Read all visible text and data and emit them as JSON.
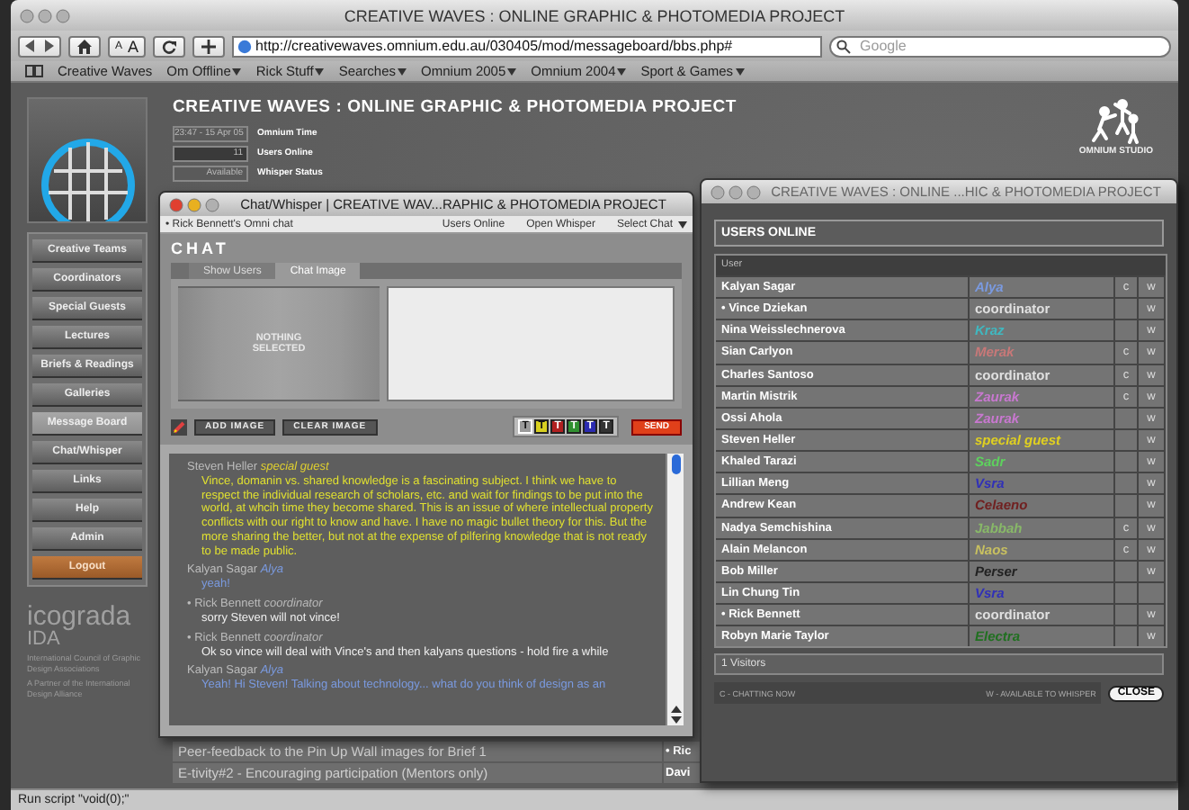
{
  "browser": {
    "title": "CREATIVE WAVES : ONLINE GRAPHIC & PHOTOMEDIA PROJECT",
    "font_buttons": [
      "A",
      "A"
    ],
    "url": "http://creativewaves.omnium.edu.au/030405/mod/messageboard/bbs.php#",
    "search": {
      "placeholder": "Google"
    },
    "bookmarks": [
      {
        "label": "Creative Waves",
        "menu": false
      },
      {
        "label": "Om Offline",
        "menu": true
      },
      {
        "label": "Rick Stuff",
        "menu": true
      },
      {
        "label": "Searches",
        "menu": true
      },
      {
        "label": "Omnium 2005",
        "menu": true
      },
      {
        "label": "Omnium 2004",
        "menu": true
      },
      {
        "label": "Sport & Games",
        "menu": true
      }
    ],
    "status_bar": "Run script \"void(0);\""
  },
  "header": {
    "title": "CREATIVE WAVES : ONLINE GRAPHIC & PHOTOMEDIA PROJECT",
    "studio": "OMNIUM STUDIO",
    "info": [
      {
        "value": "23:47 - 15 Apr 05",
        "label": "Omnium Time"
      },
      {
        "value": "11",
        "label": "Users Online"
      },
      {
        "value": "Available",
        "label": "Whisper Status"
      }
    ]
  },
  "sidebar": {
    "items": [
      {
        "label": "Creative Teams",
        "kind": "nav",
        "selected": false
      },
      {
        "label": "Coordinators",
        "kind": "nav",
        "selected": false
      },
      {
        "label": "Special Guests",
        "kind": "nav",
        "selected": false
      },
      {
        "label": "Lectures",
        "kind": "nav",
        "selected": false
      },
      {
        "label": "Briefs & Readings",
        "kind": "nav",
        "selected": false
      },
      {
        "label": "Galleries",
        "kind": "nav",
        "selected": false
      },
      {
        "label": "Message Board",
        "kind": "nav",
        "selected": true
      },
      {
        "label": "Chat/Whisper",
        "kind": "nav",
        "selected": false
      },
      {
        "label": "Links",
        "kind": "nav",
        "selected": false
      },
      {
        "label": "Help",
        "kind": "nav",
        "selected": false
      },
      {
        "label": "Admin",
        "kind": "nav",
        "selected": false
      },
      {
        "label": "Logout",
        "kind": "logout",
        "selected": false
      }
    ],
    "partner": {
      "name": "icograda",
      "sub": "IDA",
      "lines": [
        "International Council of Graphic Design Associations",
        "A Partner of the International Design Alliance"
      ]
    }
  },
  "message_board": {
    "rows": [
      {
        "topic": "Peer-feedback to the Pin Up Wall images for Brief 1",
        "author": "• Ric"
      },
      {
        "topic": "E-tivity#2 - Encouraging participation (Mentors only)",
        "author": "Davi"
      }
    ]
  },
  "chat_window": {
    "title": "Chat/Whisper | CREATIVE WAV...RAPHIC & PHOTOMEDIA PROJECT",
    "active": true,
    "room": "• Rick Bennett's Omni chat",
    "menu": [
      "Users Online",
      "Open Whisper",
      "Select Chat"
    ],
    "heading": "CHAT",
    "tabs": [
      {
        "label": "Show Users",
        "selected": false
      },
      {
        "label": "Chat Image",
        "selected": true
      }
    ],
    "image_placeholder": "NOTHING SELECTED",
    "buttons": [
      "ADD IMAGE",
      "CLEAR IMAGE"
    ],
    "text_colors": [
      {
        "label": "T",
        "color": "#9a9a9a",
        "selected": true
      },
      {
        "label": "T",
        "color": "#d8d020",
        "selected": false
      },
      {
        "label": "T",
        "color": "#b02020",
        "selected": false
      },
      {
        "label": "T",
        "color": "#309030",
        "selected": false
      },
      {
        "label": "T",
        "color": "#2a2ab0",
        "selected": false
      },
      {
        "label": "T",
        "color": "#333333",
        "selected": false
      }
    ],
    "send": "SEND",
    "messages": [
      {
        "author": "Steven Heller",
        "role": {
          "text": "special guest",
          "color": "#e0d030"
        },
        "color": "#e0e030",
        "text": "Vince, domanin vs. shared knowledge is a fascinating subject. I think we have to respect the individual research of scholars, etc. and wait for findings to be put into the world, at whcih time they become shared. This is an issue of where intellectual property conflicts with our right to know and have. I have no magic bullet theory for this. But the more sharing the better, but not at the expense of pilfering knowledge that is not ready to be made public."
      },
      {
        "author": "Kalyan Sagar",
        "role": {
          "text": "Alya",
          "color": "#7a9ae0"
        },
        "color": "#7a9ae0",
        "text": "yeah!"
      },
      {
        "author": "• Rick Bennett",
        "role": {
          "text": "coordinator",
          "color": "#b8b8b8"
        },
        "color": "#f0f0f0",
        "text": "sorry Steven will not vince!"
      },
      {
        "author": "• Rick Bennett",
        "role": {
          "text": "coordinator",
          "color": "#b8b8b8"
        },
        "color": "#f0f0f0",
        "text": "Ok so vince will deal with Vince's and then kalyans questions - hold fire a while"
      },
      {
        "author": "Kalyan Sagar",
        "role": {
          "text": "Alya",
          "color": "#7a9ae0"
        },
        "color": "#7a9ae0",
        "text": "Yeah! Hi Steven! Talking about technology... what do you think of design as an"
      }
    ]
  },
  "users_window": {
    "title": "CREATIVE WAVES : ONLINE ...HIC & PHOTOMEDIA PROJECT",
    "active": false,
    "heading": "USERS ONLINE",
    "column": "User",
    "users": [
      {
        "name": "Kalyan Sagar",
        "role": "Alya",
        "kind": "member",
        "color": "#7a9ae0",
        "chat": "c",
        "whisper": "w"
      },
      {
        "name": "• Vince Dziekan",
        "role": "coordinator",
        "kind": "coordinator",
        "color": "#e0e0e0",
        "whisper": "w"
      },
      {
        "name": "Nina Weisslechnerova",
        "role": "Kraz",
        "kind": "member",
        "color": "#40b8c0",
        "whisper": "w"
      },
      {
        "name": "Sian Carlyon",
        "role": "Merak",
        "kind": "member",
        "color": "#c87878",
        "chat": "c",
        "whisper": "w"
      },
      {
        "name": "Charles Santoso",
        "role": "coordinator",
        "kind": "coordinator",
        "color": "#e0e0e0",
        "chat": "c",
        "whisper": "w"
      },
      {
        "name": "Martin Mistrik",
        "role": "Zaurak",
        "kind": "member",
        "color": "#c878d0",
        "chat": "c",
        "whisper": "w"
      },
      {
        "name": "Ossi Ahola",
        "role": "Zaurak",
        "kind": "member",
        "color": "#c878d0",
        "whisper": "w"
      },
      {
        "name": "Steven Heller",
        "role": "special guest",
        "kind": "member",
        "color": "#e0d020",
        "whisper": "w"
      },
      {
        "name": "Khaled Tarazi",
        "role": "Sadr",
        "kind": "member",
        "color": "#5ed05e",
        "whisper": "w"
      },
      {
        "name": "Lillian Meng",
        "role": "Vsra",
        "kind": "member",
        "color": "#3030b8",
        "whisper": "w"
      },
      {
        "name": "Andrew Kean",
        "role": "Celaeno",
        "kind": "member",
        "color": "#702020",
        "whisper": "w"
      },
      {
        "name": "Nadya Semchishina",
        "role": "Jabbah",
        "kind": "member",
        "color": "#88b868",
        "chat": "c",
        "whisper": "w"
      },
      {
        "name": "Alain Melancon",
        "role": "Naos",
        "kind": "member",
        "color": "#c8c060",
        "chat": "c",
        "whisper": "w"
      },
      {
        "name": "Bob Miller",
        "role": "Perser",
        "kind": "member",
        "color": "#222222",
        "whisper": "w"
      },
      {
        "name": "Lin Chung Tin",
        "role": "Vsra",
        "kind": "member",
        "color": "#3030b8"
      },
      {
        "name": "• Rick Bennett",
        "role": "coordinator",
        "kind": "coordinator",
        "color": "#e0e0e0",
        "whisper": "w"
      },
      {
        "name": "Robyn Marie Taylor",
        "role": "Electra",
        "kind": "member",
        "color": "#207020",
        "whisper": "w"
      }
    ],
    "visitors": "1 Visitors",
    "legend": [
      "C - CHATTING NOW",
      "W - AVAILABLE TO WHISPER"
    ],
    "close": "CLOSE"
  }
}
